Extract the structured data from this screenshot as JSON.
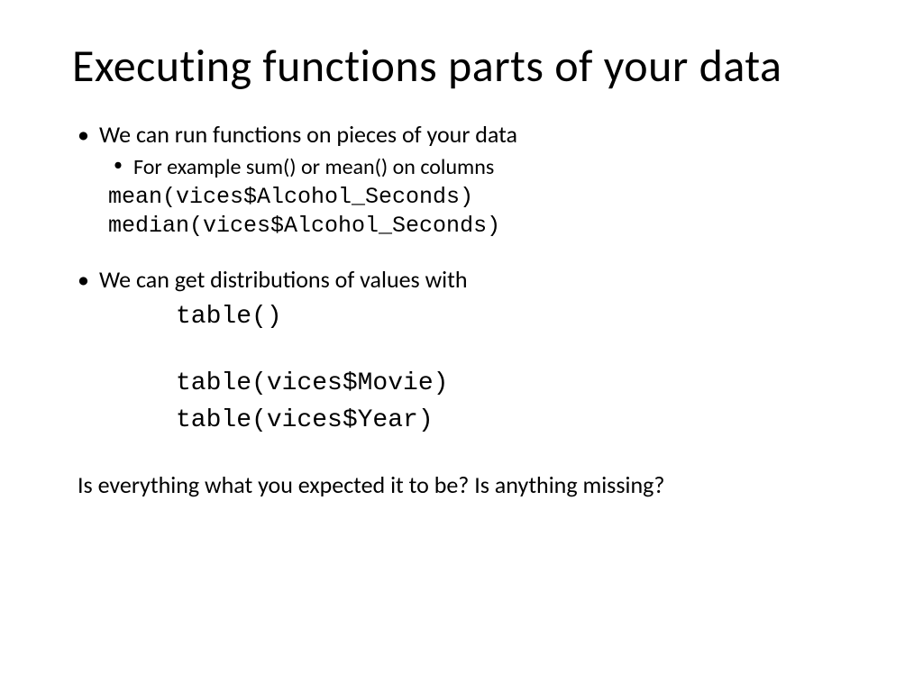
{
  "title": "Executing functions parts of your data",
  "bullet1": "We can run functions on pieces of your data",
  "bullet1_sub": "For example sum() or mean() on columns",
  "code1_line1": "mean(vices$Alcohol_Seconds)",
  "code1_line2": "median(vices$Alcohol_Seconds)",
  "bullet2": "We can get distributions of values with",
  "code2_line1": "table()",
  "code2_line2": "table(vices$Movie)",
  "code2_line3": "table(vices$Year)",
  "closing": "Is everything what you expected it to be? Is anything missing?"
}
